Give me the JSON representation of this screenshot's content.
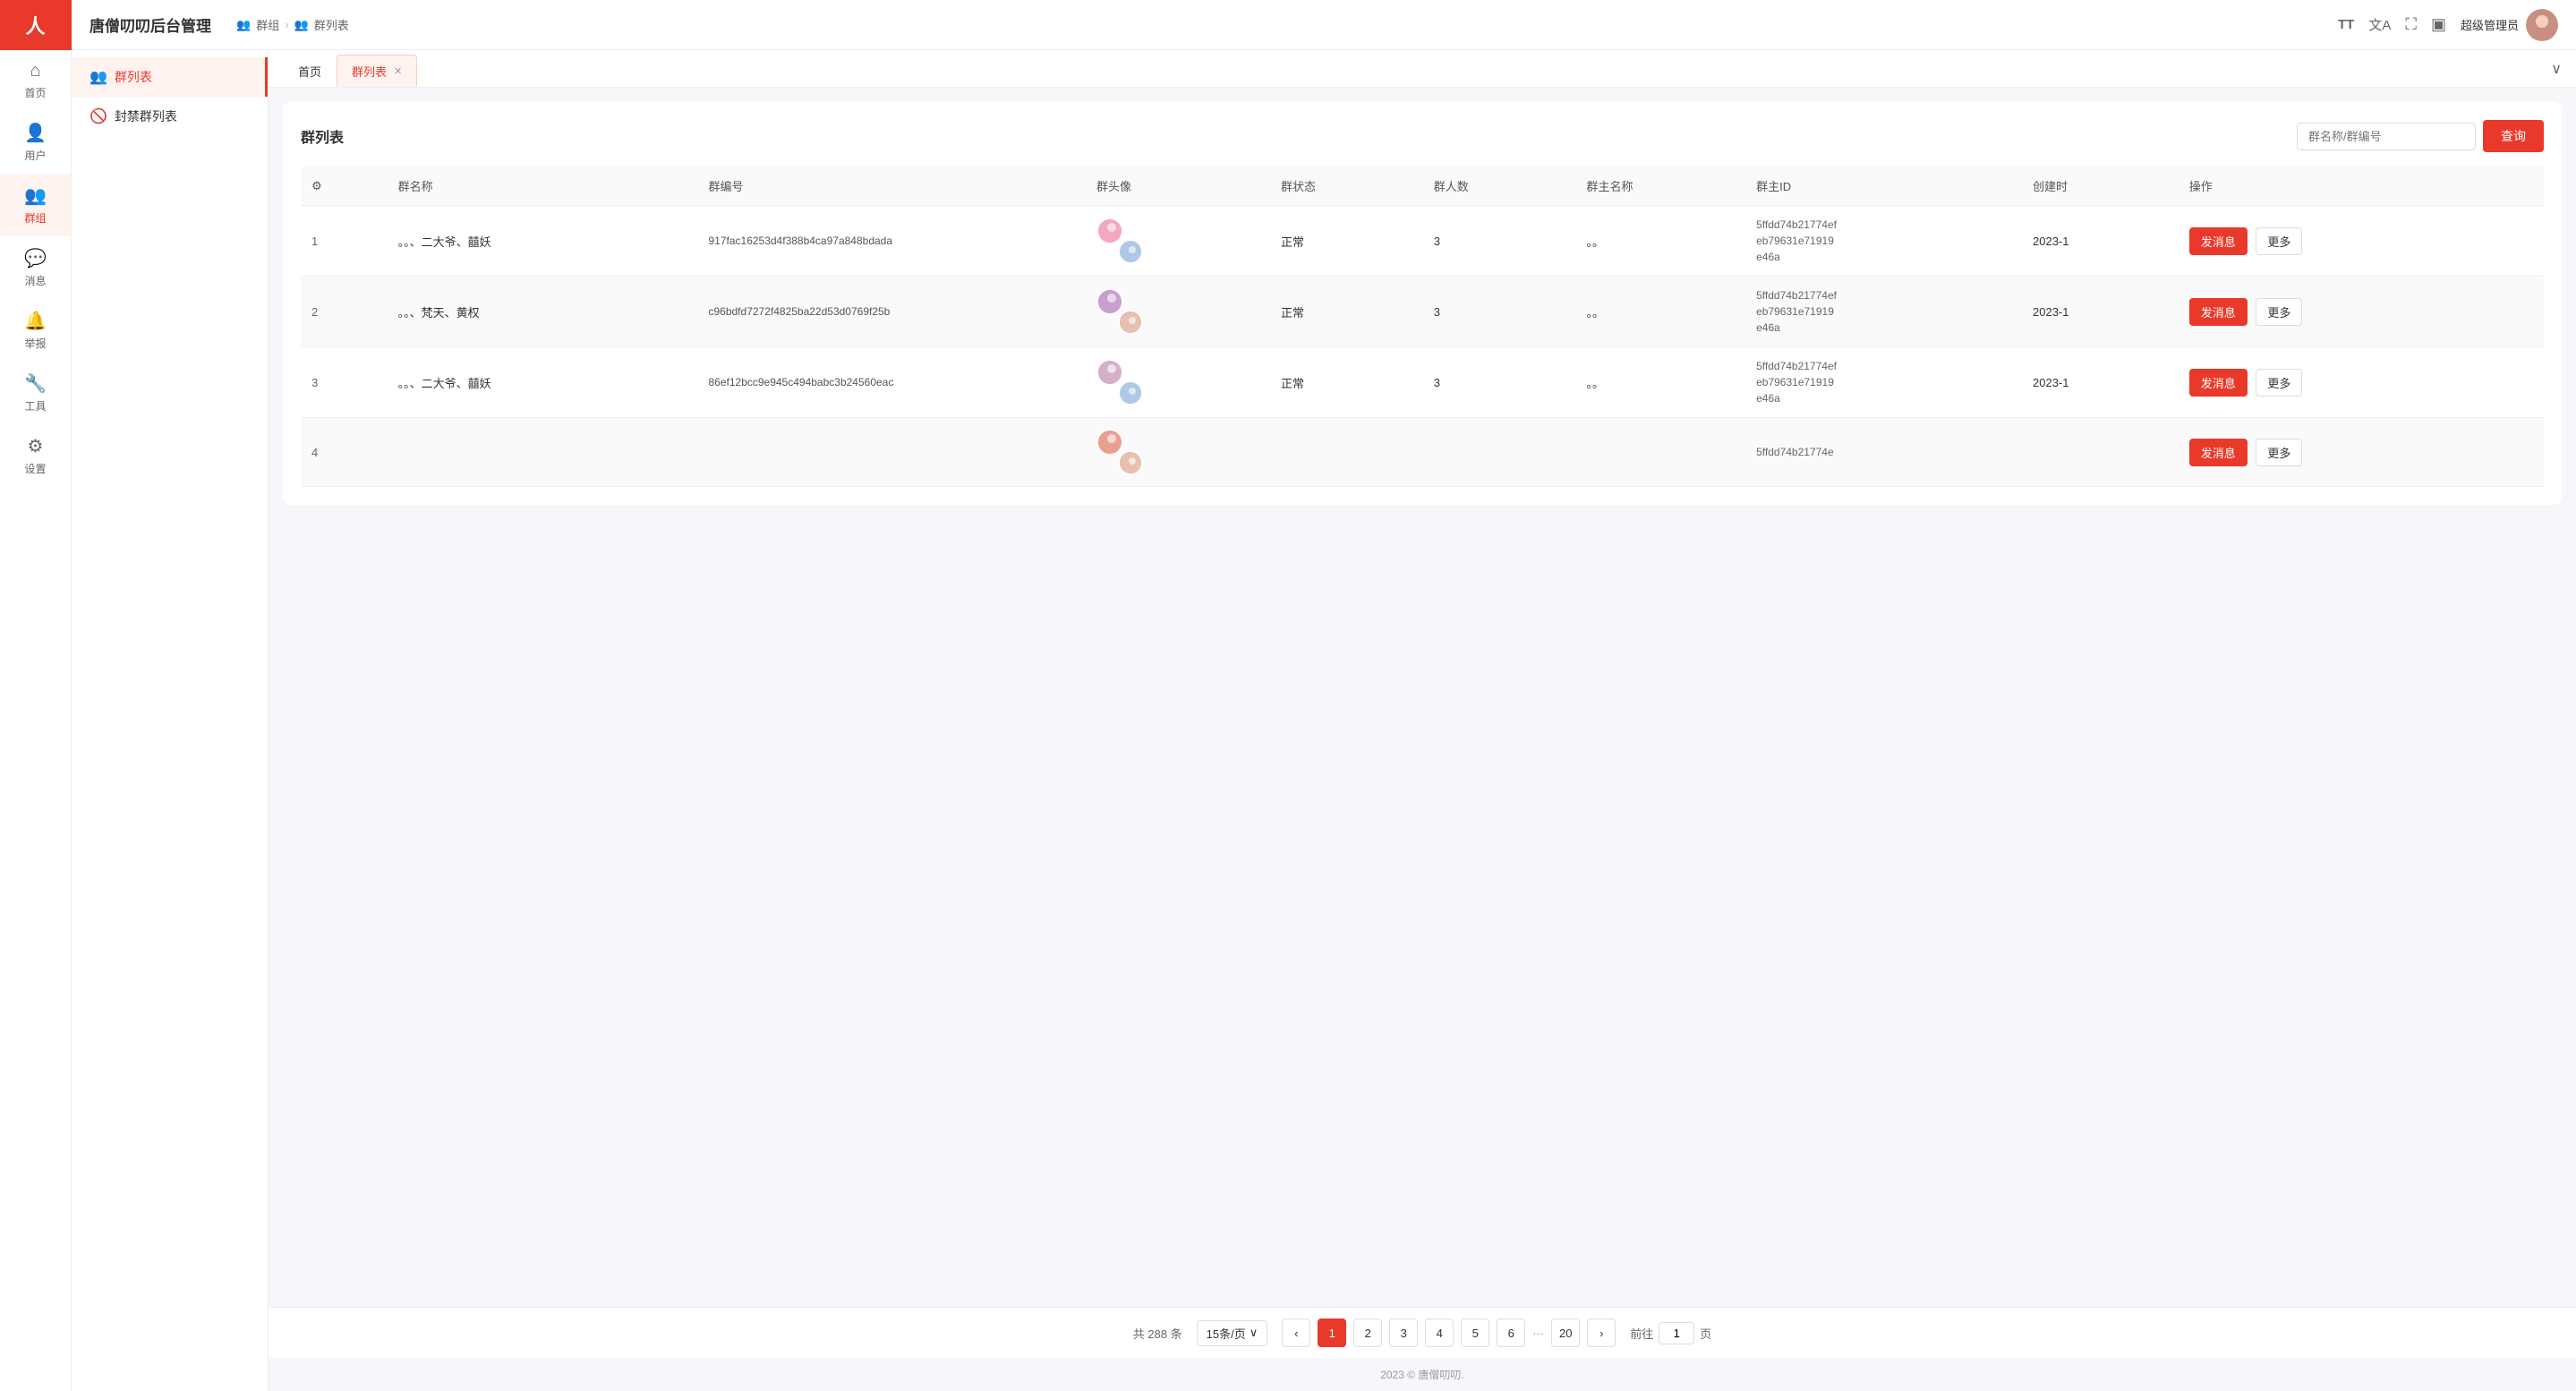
{
  "app": {
    "title": "唐僧叨叨后台管理",
    "logo": "人"
  },
  "sidebar": {
    "items": [
      {
        "id": "home",
        "label": "首页",
        "icon": "⌂",
        "active": false
      },
      {
        "id": "user",
        "label": "用户",
        "icon": "👤",
        "active": false
      },
      {
        "id": "group",
        "label": "群组",
        "icon": "👥",
        "active": true
      },
      {
        "id": "message",
        "label": "消息",
        "icon": "💬",
        "active": false
      },
      {
        "id": "report",
        "label": "举报",
        "icon": "🔔",
        "active": false
      },
      {
        "id": "tool",
        "label": "工具",
        "icon": "🔧",
        "active": false
      },
      {
        "id": "setting",
        "label": "设置",
        "icon": "⚙",
        "active": false
      }
    ]
  },
  "header": {
    "breadcrumb_icon": "👥",
    "breadcrumb_group": "群组",
    "breadcrumb_sep": "›",
    "breadcrumb_page": "群列表",
    "icons": [
      "TT",
      "文A",
      "⛶",
      "□"
    ],
    "username": "超级管理员"
  },
  "left_nav": {
    "items": [
      {
        "id": "group-list",
        "label": "群列表",
        "icon": "👥",
        "active": true
      },
      {
        "id": "banned-list",
        "label": "封禁群列表",
        "icon": "🚫",
        "active": false
      }
    ]
  },
  "tabs": {
    "items": [
      {
        "id": "home",
        "label": "首页",
        "active": false,
        "closable": false
      },
      {
        "id": "group-list",
        "label": "群列表",
        "active": true,
        "closable": true
      }
    ],
    "collapse_icon": "∨"
  },
  "table": {
    "title": "群列表",
    "search_placeholder": "群名称/群编号",
    "search_btn": "查询",
    "columns": [
      {
        "key": "settings",
        "label": "⚙"
      },
      {
        "key": "name",
        "label": "群名称"
      },
      {
        "key": "code",
        "label": "群编号"
      },
      {
        "key": "avatar",
        "label": "群头像"
      },
      {
        "key": "status",
        "label": "群状态"
      },
      {
        "key": "count",
        "label": "群人数"
      },
      {
        "key": "owner_name",
        "label": "群主名称"
      },
      {
        "key": "owner_id",
        "label": "群主ID"
      },
      {
        "key": "create_time",
        "label": "创建时"
      },
      {
        "key": "action",
        "label": "操作"
      }
    ],
    "rows": [
      {
        "index": 1,
        "name": "。。、二大爷、囍妖",
        "code": "917fac16253d4f388b4ca97a848bdada",
        "avatar_bg": "#f4a8c0",
        "status": "正常",
        "count": 3,
        "owner_name": "。。",
        "owner_id": "5ffdd74b21774efeb79631e71919e46a",
        "create_time": "2023-1",
        "action_send": "发消息",
        "action_more": "更多"
      },
      {
        "index": 2,
        "name": "。。、梵天、黄权",
        "code": "c96bdfd7272f4825ba22d53d0769f25b",
        "avatar_bg": "#c8a0d0",
        "status": "正常",
        "count": 3,
        "owner_name": "。。",
        "owner_id": "5ffdd74b21774efeb79631e71919e46a",
        "create_time": "2023-1",
        "action_send": "发消息",
        "action_more": "更多"
      },
      {
        "index": 3,
        "name": "。。、二大爷、囍妖",
        "code": "86ef12bcc9e945c494babc3b24560eac",
        "avatar_bg": "#d4a0b8",
        "status": "正常",
        "count": 3,
        "owner_name": "。。",
        "owner_id": "5ffdd74b21774efeb79631e71919e46a",
        "create_time": "2023-1",
        "action_send": "发消息",
        "action_more": "更多"
      },
      {
        "index": 4,
        "name": "",
        "code": "",
        "avatar_bg": "#e8a090",
        "status": "",
        "count": "",
        "owner_name": "",
        "owner_id": "5ffdd74b21774e",
        "create_time": "",
        "action_send": "发消息",
        "action_more": "更多"
      }
    ]
  },
  "pagination": {
    "total_text": "共 288 条",
    "page_size": "15条/页",
    "prev_icon": "‹",
    "next_icon": "›",
    "pages": [
      1,
      2,
      3,
      4,
      5,
      6
    ],
    "dots": "···",
    "last_page": 20,
    "current": 1,
    "goto_label_before": "前往",
    "goto_value": "1",
    "goto_label_after": "页"
  },
  "footer": {
    "text": "2023 © 唐僧叨叨."
  }
}
